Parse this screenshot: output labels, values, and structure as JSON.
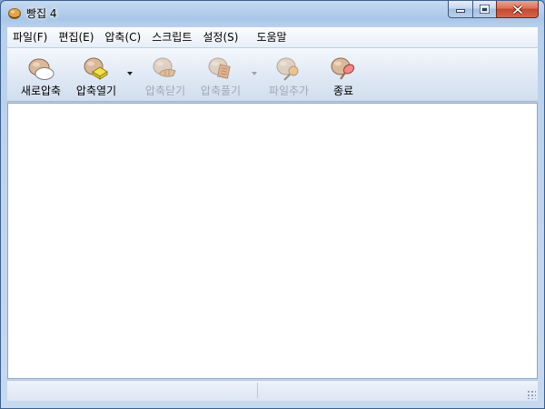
{
  "window": {
    "title": "빵집 4",
    "icon": "bread-app-icon"
  },
  "caption_buttons": [
    {
      "name": "minimize-button",
      "icon": "minimize-icon"
    },
    {
      "name": "maximize-button",
      "icon": "maximize-icon"
    },
    {
      "name": "close-button",
      "icon": "close-icon"
    }
  ],
  "menu": {
    "items": [
      "파일(F)",
      "편집(E)",
      "압축(C)",
      "스크립트",
      "설정(S)",
      "도움말"
    ]
  },
  "toolbar": {
    "new_archive": {
      "label": "새로압축",
      "icon": "new-archive-icon",
      "enabled": true
    },
    "open_archive": {
      "label": "압축열기",
      "icon": "open-archive-icon",
      "enabled": true
    },
    "close_archive": {
      "label": "압축닫기",
      "icon": "close-archive-icon",
      "enabled": false
    },
    "extract": {
      "label": "압축풀기",
      "icon": "extract-icon",
      "enabled": false
    },
    "add_files": {
      "label": "파일추가",
      "icon": "add-files-icon",
      "enabled": false
    },
    "exit": {
      "label": "종료",
      "icon": "exit-icon",
      "enabled": true
    }
  },
  "colors": {
    "disabled_text": "#a1a8b3",
    "bread": "#d9b99a",
    "close_button_red": "#c44a2f"
  }
}
